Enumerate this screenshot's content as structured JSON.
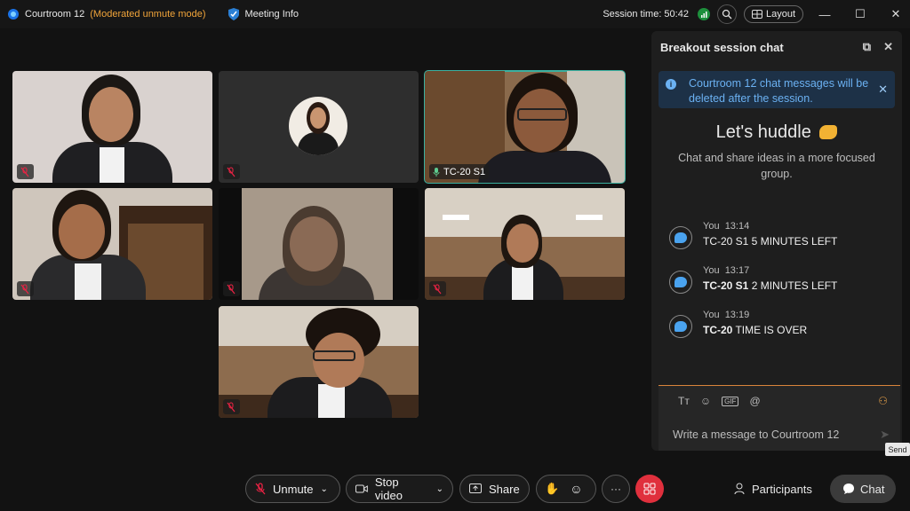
{
  "titlebar": {
    "meeting_name": "Courtroom 12",
    "mode": "(Moderated unmute mode)",
    "meeting_info": "Meeting Info",
    "session_time": "Session time: 50:42",
    "layout": "Layout"
  },
  "tiles": [
    {
      "label": ""
    },
    {
      "label": ""
    },
    {
      "label": "TC-20 S1"
    },
    {
      "label": ""
    },
    {
      "label": ""
    },
    {
      "label": ""
    },
    {
      "label": ""
    }
  ],
  "chat": {
    "title": "Breakout session chat",
    "notice": "Courtroom 12 chat messages will be deleted after the session.",
    "huddle_title": "Let's huddle",
    "huddle_sub": "Chat and share ideas in a more focused group.",
    "messages": [
      {
        "sender": "You",
        "time": "13:14",
        "text": "TC-20 S1 5 MINUTES LEFT",
        "bold": ""
      },
      {
        "sender": "You",
        "time": "13:17",
        "text": " 2 MINUTES LEFT",
        "bold": "TC-20 S1"
      },
      {
        "sender": "You",
        "time": "13:19",
        "text": " TIME IS OVER",
        "bold": "TC-20"
      }
    ],
    "compose_placeholder": "Write a message to Courtroom 12",
    "send_tooltip": "Send"
  },
  "controls": {
    "unmute": "Unmute",
    "stop_video": "Stop video",
    "share": "Share",
    "participants": "Participants",
    "chat": "Chat"
  }
}
